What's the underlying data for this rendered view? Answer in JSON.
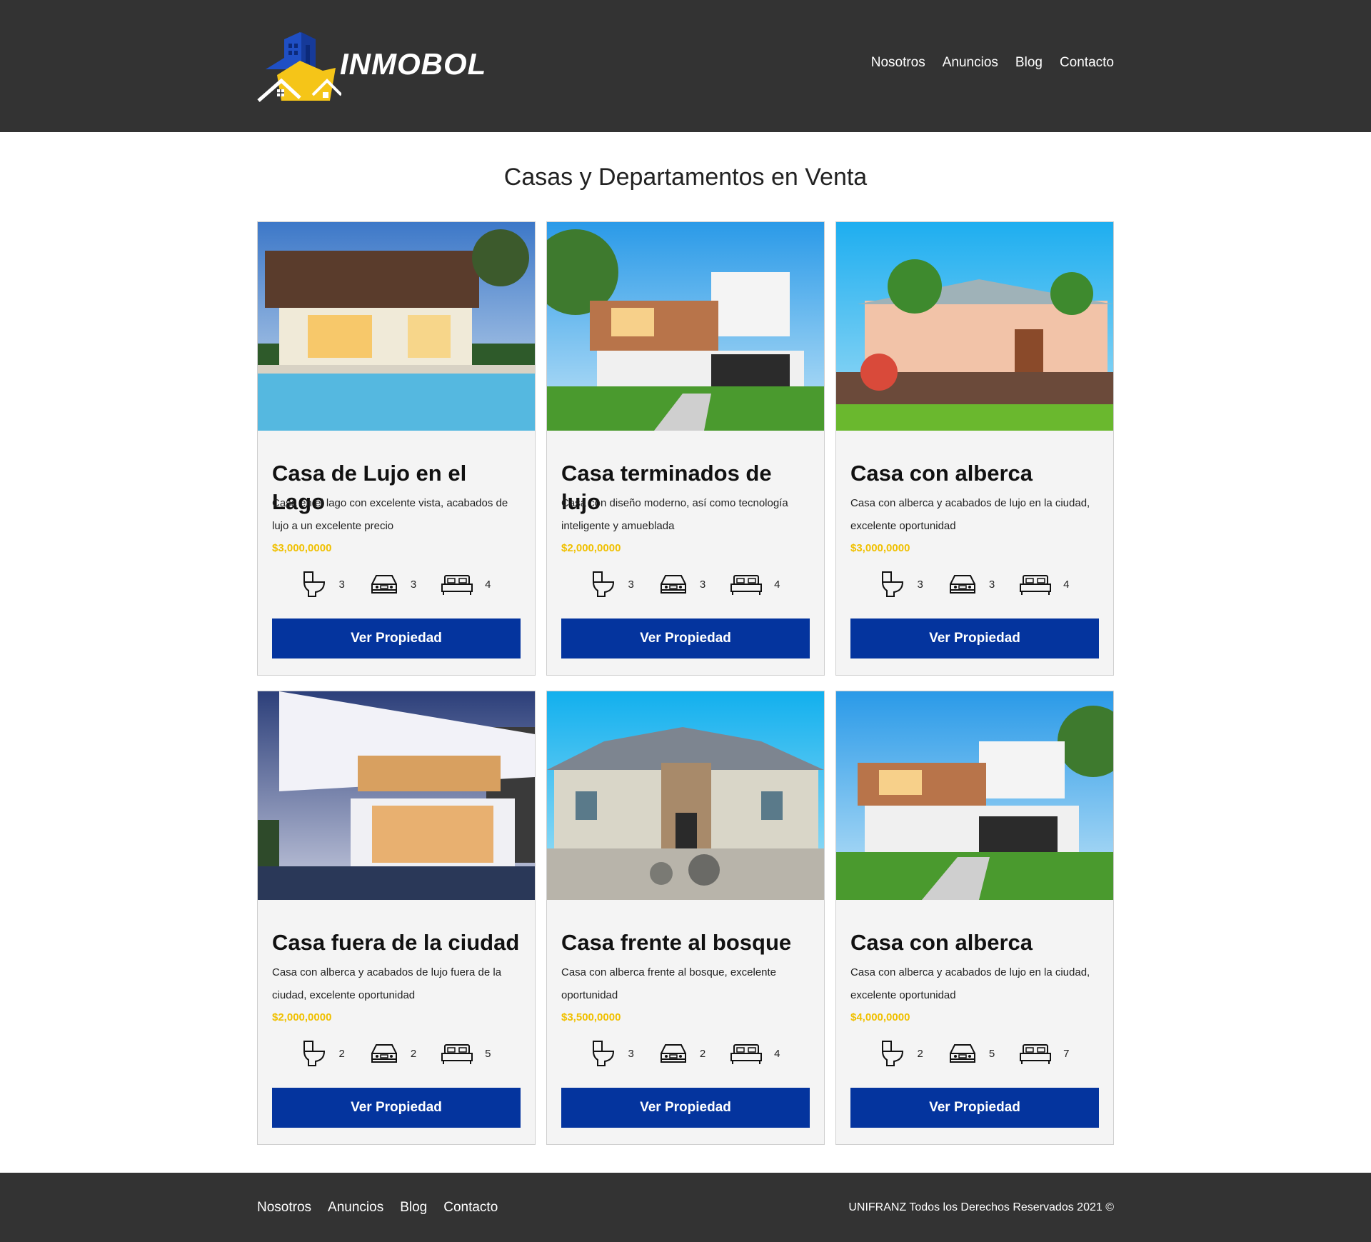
{
  "brand": {
    "name": "INMOBOL"
  },
  "nav": [
    {
      "label": "Nosotros"
    },
    {
      "label": "Anuncios"
    },
    {
      "label": "Blog"
    },
    {
      "label": "Contacto"
    }
  ],
  "main": {
    "title": "Casas y Departamentos en Venta"
  },
  "listings": [
    {
      "title": "Casa de Lujo en el Lago",
      "description": "Casa en el lago con excelente vista, acabados de lujo a un excelente precio",
      "price": "$3,000,0000",
      "baths": "3",
      "parking": "3",
      "bedrooms": "4",
      "button": "Ver Propiedad"
    },
    {
      "title": "Casa terminados de lujo",
      "description": "Casa con diseño moderno, así como tecnología inteligente y amueblada",
      "price": "$2,000,0000",
      "baths": "3",
      "parking": "3",
      "bedrooms": "4",
      "button": "Ver Propiedad"
    },
    {
      "title": "Casa con alberca",
      "description": "Casa con alberca y acabados de lujo en la ciudad, excelente oportunidad",
      "price": "$3,000,0000",
      "baths": "3",
      "parking": "3",
      "bedrooms": "4",
      "button": "Ver Propiedad"
    },
    {
      "title": "Casa fuera de la ciudad",
      "description": "Casa con alberca y acabados de lujo fuera de la ciudad, excelente oportunidad",
      "price": "$2,000,0000",
      "baths": "2",
      "parking": "2",
      "bedrooms": "5",
      "button": "Ver Propiedad"
    },
    {
      "title": "Casa frente al bosque",
      "description": "Casa con alberca frente al bosque, excelente oportunidad",
      "price": "$3,500,0000",
      "baths": "3",
      "parking": "2",
      "bedrooms": "4",
      "button": "Ver Propiedad"
    },
    {
      "title": "Casa con alberca",
      "description": "Casa con alberca y acabados de lujo en la ciudad, excelente oportunidad",
      "price": "$4,000,0000",
      "baths": "2",
      "parking": "5",
      "bedrooms": "7",
      "button": "Ver Propiedad"
    }
  ],
  "footer": {
    "nav": [
      {
        "label": "Nosotros"
      },
      {
        "label": "Anuncios"
      },
      {
        "label": "Blog"
      },
      {
        "label": "Contacto"
      }
    ],
    "copyright": "UNIFRANZ Todos los Derechos Reservados 2021 ©"
  },
  "colors": {
    "header_bg": "#333333",
    "accent_blue": "#04349e",
    "price_yellow": "#f0c000",
    "card_bg": "#f4f4f4"
  }
}
